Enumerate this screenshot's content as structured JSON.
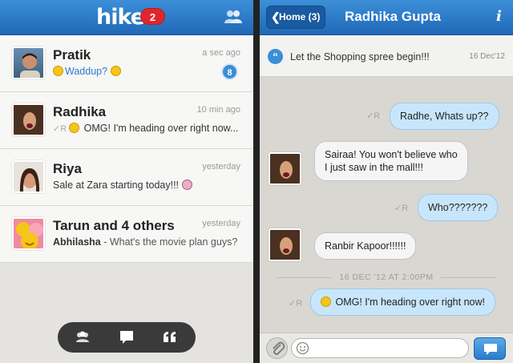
{
  "left": {
    "app_logo": "hike",
    "notification_count": "2",
    "chats": [
      {
        "name": "Pratik",
        "time": "a sec ago",
        "preview": "Waddup?",
        "unread": "8"
      },
      {
        "name": "Radhika",
        "time": "10 min ago",
        "status": "R",
        "preview": "OMG! I'm heading over right now..."
      },
      {
        "name": "Riya",
        "time": "yesterday",
        "preview": "Sale at Zara starting today!!!"
      },
      {
        "name": "Tarun and 4 others",
        "time": "yesterday",
        "sender": "Abhilasha",
        "preview": " - What's the movie plan guys?"
      }
    ]
  },
  "right": {
    "back_label": "Home (3)",
    "title": "Radhika Gupta",
    "info_label": "i",
    "pinned": {
      "text": "Let the Shopping spree begin!!!",
      "date": "16 Dec'12"
    },
    "messages": [
      {
        "text": "Radhe, Whats up??",
        "status": "R"
      },
      {
        "text": "Sairaa! You won't believe who",
        "text2": "I just saw in the mall!!!"
      },
      {
        "text": "Who???????",
        "status": "R"
      },
      {
        "text": "Ranbir Kapoor!!!!!!"
      },
      {
        "text": "OMG! I'm heading over right now!",
        "status": "R"
      }
    ],
    "date_divider": "16 DEC '12 AT 2:00PM",
    "compose_placeholder": ""
  },
  "colors": {
    "brand_blue": "#2068b7",
    "badge_red": "#e0262b",
    "bubble_out": "#c8e6fb"
  }
}
